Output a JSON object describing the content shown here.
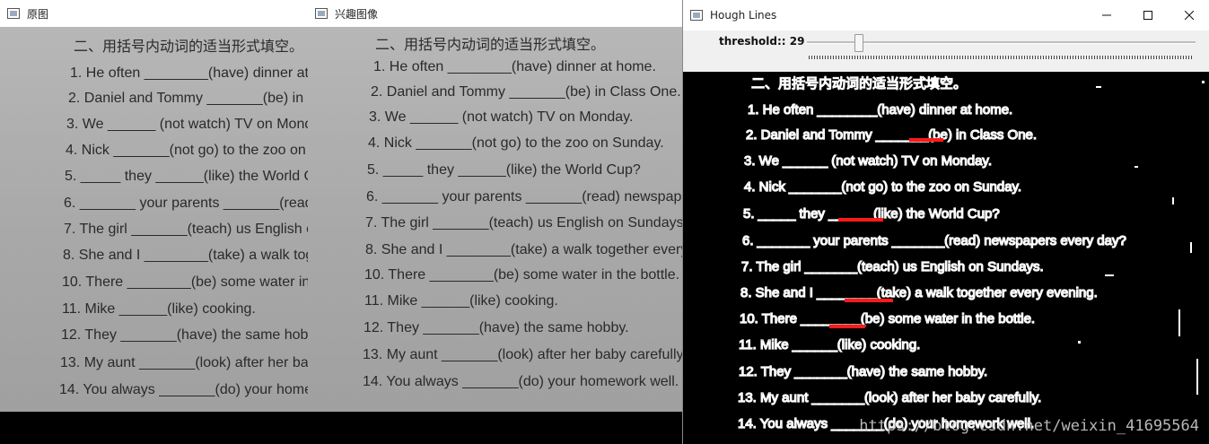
{
  "windows": [
    {
      "title": "原图"
    },
    {
      "title": "兴趣图像"
    },
    {
      "title": "Hough Lines",
      "trackbar_label": "threshold:: 29",
      "trackbar_value": 29
    }
  ],
  "worksheet": {
    "heading": "二、用括号内动词的适当形式填空。",
    "lines": [
      "1. He often ________(have) dinner at home.",
      "2. Daniel and Tommy _______(be) in Class One.",
      "3. We ______      (not watch) TV on Monday.",
      "4. Nick _______(not go) to the zoo on Sunday.",
      "5. _____ they ______(like) the World Cup?",
      "6. _______ your parents _______(read) newspapers every day?",
      "7. The girl _______(teach) us English on Sundays.",
      "8. She and I ________(take) a walk together every evening.",
      "10. There ________(be) some water in the bottle.",
      "11. Mike ______(like) cooking.",
      "12. They _______(have) the same hobby.",
      "13. My aunt _______(look) after her baby carefully.",
      "14. You always _______(do) your homework well."
    ]
  },
  "watermark": "https://blog.csdn.net/weixin_41695564",
  "colors": {
    "detected_line": "#ff1a1a",
    "titlebar": "#ffffff",
    "toolbar": "#f0f0f0"
  }
}
